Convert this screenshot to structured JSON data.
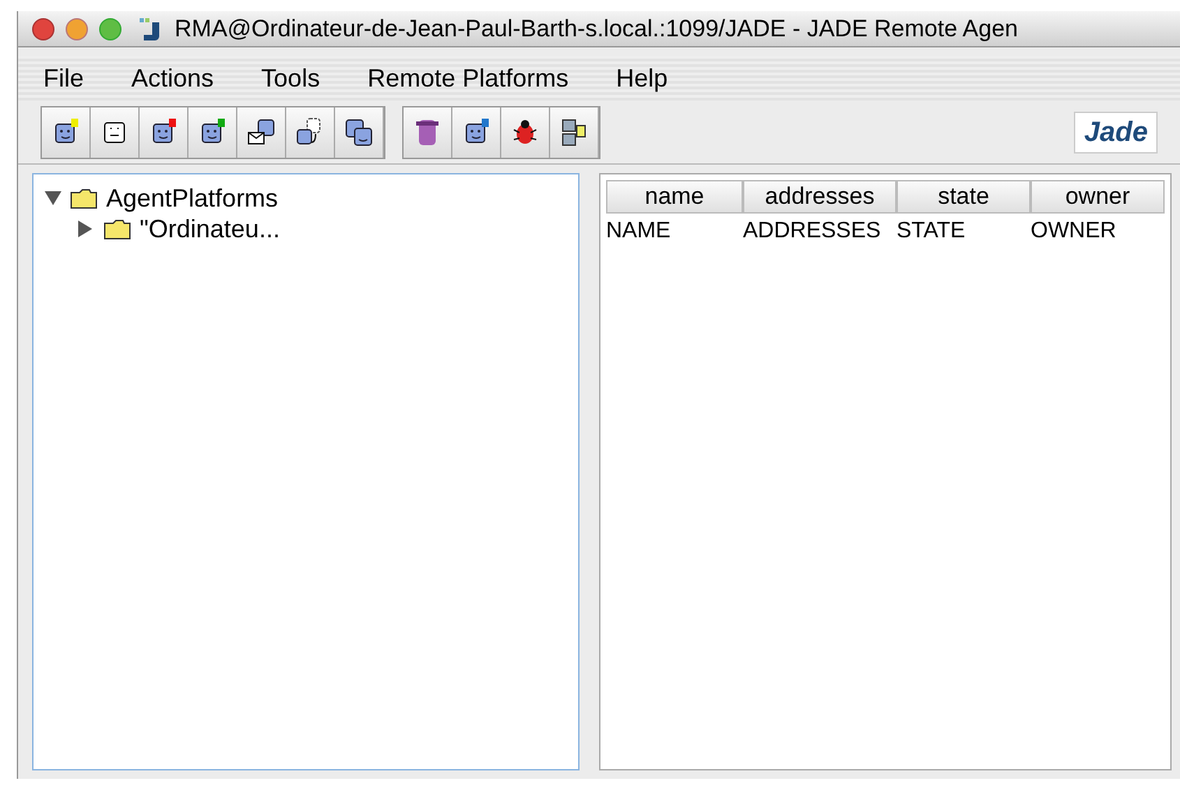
{
  "window": {
    "title": "RMA@Ordinateur-de-Jean-Paul-Barth-s.local.:1099/JADE - JADE Remote Agen"
  },
  "menu": [
    "File",
    "Actions",
    "Tools",
    "Remote Platforms",
    "Help"
  ],
  "toolbar": {
    "groups": [
      [
        {
          "kind": "new"
        },
        {
          "kind": "kill"
        },
        {
          "kind": "suspend"
        },
        {
          "kind": "resume"
        },
        {
          "kind": "message"
        },
        {
          "kind": "migrate"
        },
        {
          "kind": "clone"
        }
      ],
      [
        {
          "kind": "sniffer"
        },
        {
          "kind": "dummy"
        },
        {
          "kind": "introspector"
        },
        {
          "kind": "log"
        }
      ]
    ],
    "logo": "Jade"
  },
  "tree": [
    {
      "label": "AgentPlatforms",
      "expanded": true,
      "children": [
        {
          "label": "\"Ordinateu...",
          "expanded": false
        }
      ]
    }
  ],
  "table": {
    "columns": [
      "name",
      "addresses",
      "state",
      "owner"
    ],
    "rows": [
      [
        "NAME",
        "ADDRESSES",
        "STATE",
        "OWNER"
      ]
    ]
  }
}
